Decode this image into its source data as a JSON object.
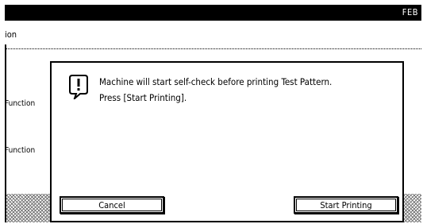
{
  "statusbar": {
    "month": "FEB"
  },
  "background": {
    "title_fragment": "ion",
    "items": [
      "Function",
      "Function"
    ]
  },
  "dialog": {
    "icon": "info-icon",
    "lines": [
      "Machine will start self-check before printing Test Pattern.",
      "Press [Start Printing]."
    ],
    "buttons": {
      "cancel": "Cancel",
      "start": "Start Printing"
    }
  }
}
